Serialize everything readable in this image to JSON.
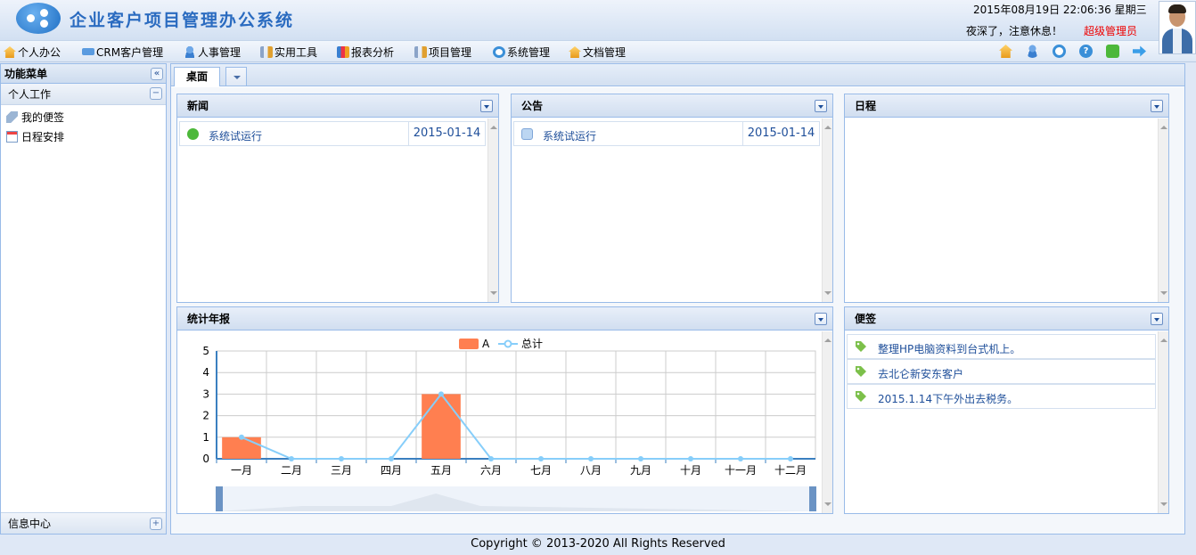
{
  "header": {
    "app_title": "企业客户项目管理办公系统",
    "datetime": "2015年08月19日 22:06:36 星期三",
    "greeting": "夜深了，注意休息！",
    "role": "超级管理员"
  },
  "menubar": {
    "items": [
      {
        "label": "个人办公",
        "icon": "home-icon"
      },
      {
        "label": "CRM客户管理",
        "icon": "card-icon"
      },
      {
        "label": "人事管理",
        "icon": "user-icon"
      },
      {
        "label": "实用工具",
        "icon": "tools-icon"
      },
      {
        "label": "报表分析",
        "icon": "chart-icon"
      },
      {
        "label": "项目管理",
        "icon": "tools-icon"
      },
      {
        "label": "系统管理",
        "icon": "gear-icon"
      },
      {
        "label": "文档管理",
        "icon": "home-icon"
      }
    ],
    "toolbar_icons": [
      "home-icon",
      "user-icon",
      "gear-icon",
      "help-icon",
      "plugin-icon",
      "logout-arrow-icon"
    ]
  },
  "left_panel": {
    "title": "功能菜单",
    "section": "个人工作",
    "items": [
      {
        "label": "我的便签",
        "icon": "tag-icon"
      },
      {
        "label": "日程安排",
        "icon": "calendar-icon"
      }
    ],
    "bottom_section": "信息中心"
  },
  "tabs": {
    "desktop": "桌面"
  },
  "news": {
    "title": "新闻",
    "rows": [
      {
        "text": "系统试运行",
        "date": "2015-01-14",
        "icon": "check-circle-icon"
      }
    ]
  },
  "notice": {
    "title": "公告",
    "rows": [
      {
        "text": "系统试运行",
        "date": "2015-01-14",
        "icon": "message-icon"
      }
    ]
  },
  "schedule": {
    "title": "日程"
  },
  "stats": {
    "title": "统计年报"
  },
  "notes": {
    "title": "便签",
    "rows": [
      {
        "text": "整理HP电脑资料到台式机上。",
        "icon": "tag-icon"
      },
      {
        "text": "去北仑新安东客户",
        "icon": "tag-icon"
      },
      {
        "text": "2015.1.14下午外出去税务。",
        "icon": "tag-icon"
      }
    ]
  },
  "chart_data": {
    "type": "bar",
    "categories": [
      "一月",
      "二月",
      "三月",
      "四月",
      "五月",
      "六月",
      "七月",
      "八月",
      "九月",
      "十月",
      "十一月",
      "十二月"
    ],
    "series": [
      {
        "name": "A",
        "type": "bar",
        "values": [
          1,
          0,
          0,
          0,
          3,
          0,
          0,
          0,
          0,
          0,
          0,
          0
        ],
        "color": "#ff7f50"
      },
      {
        "name": "总计",
        "type": "line",
        "values": [
          1,
          0,
          0,
          0,
          3,
          0,
          0,
          0,
          0,
          0,
          0,
          0
        ],
        "color": "#87cefa"
      }
    ],
    "ylim": [
      0,
      5
    ],
    "yticks": [
      0,
      1,
      2,
      3,
      4,
      5
    ],
    "grid": true,
    "legend": "top-center"
  },
  "footer": {
    "copyright": "Copyright © 2013-2020 All Rights Reserved"
  }
}
